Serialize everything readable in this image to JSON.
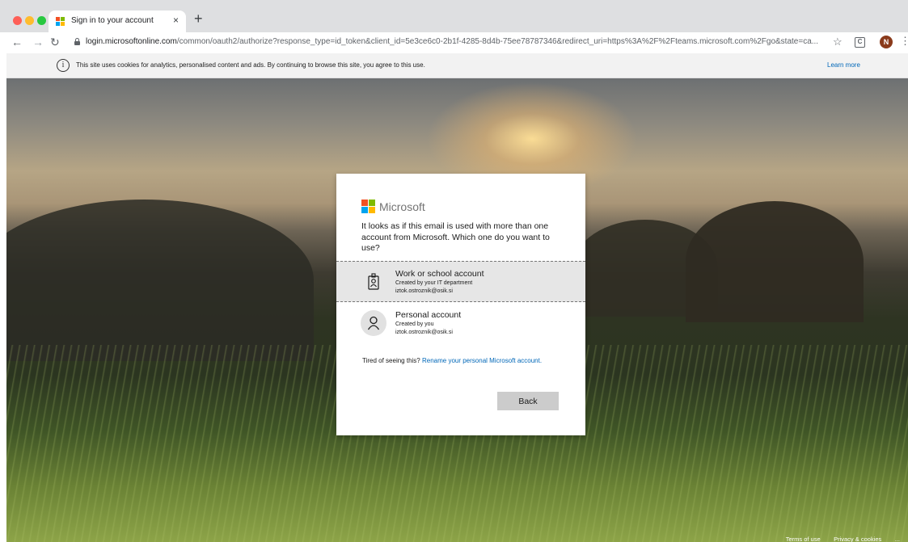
{
  "browser": {
    "tab_title": "Sign in to your account",
    "tab_close": "×",
    "new_tab": "+",
    "url_host": "login.microsoftonline.com",
    "url_path": "/common/oauth2/authorize?response_type=id_token&client_id=5e3ce6c0-2b1f-4285-8d4b-75ee78787346&redirect_uri=https%3A%2F%2Fteams.microsoft.com%2Fgo&state=ca...",
    "extension_label": "C",
    "profile_initial": "N"
  },
  "cookie_banner": {
    "text": "This site uses cookies for analytics, personalised content and ads. By continuing to browse this site, you agree to this use.",
    "learn_more": "Learn more"
  },
  "dialog": {
    "brand": "Microsoft",
    "heading": "It looks as if this email is used with more than one account from Microsoft. Which one do you want to use?",
    "accounts": [
      {
        "title": "Work or school account",
        "subtitle": "Created by your IT department",
        "email": "iztok.ostroznik@osik.si",
        "icon": "badge-icon"
      },
      {
        "title": "Personal account",
        "subtitle": "Created by you",
        "email": "iztok.ostroznik@osik.si",
        "icon": "person-icon"
      }
    ],
    "tired_text": "Tired of seeing this?",
    "rename_link": "Rename your personal Microsoft account.",
    "back_label": "Back"
  },
  "footer": {
    "terms": "Terms of use",
    "privacy": "Privacy & cookies",
    "more": "..."
  },
  "colors": {
    "accent_link": "#0067b8",
    "ms_red": "#f25022",
    "ms_green": "#7fba00",
    "ms_blue": "#00a4ef",
    "ms_yellow": "#ffb900"
  }
}
